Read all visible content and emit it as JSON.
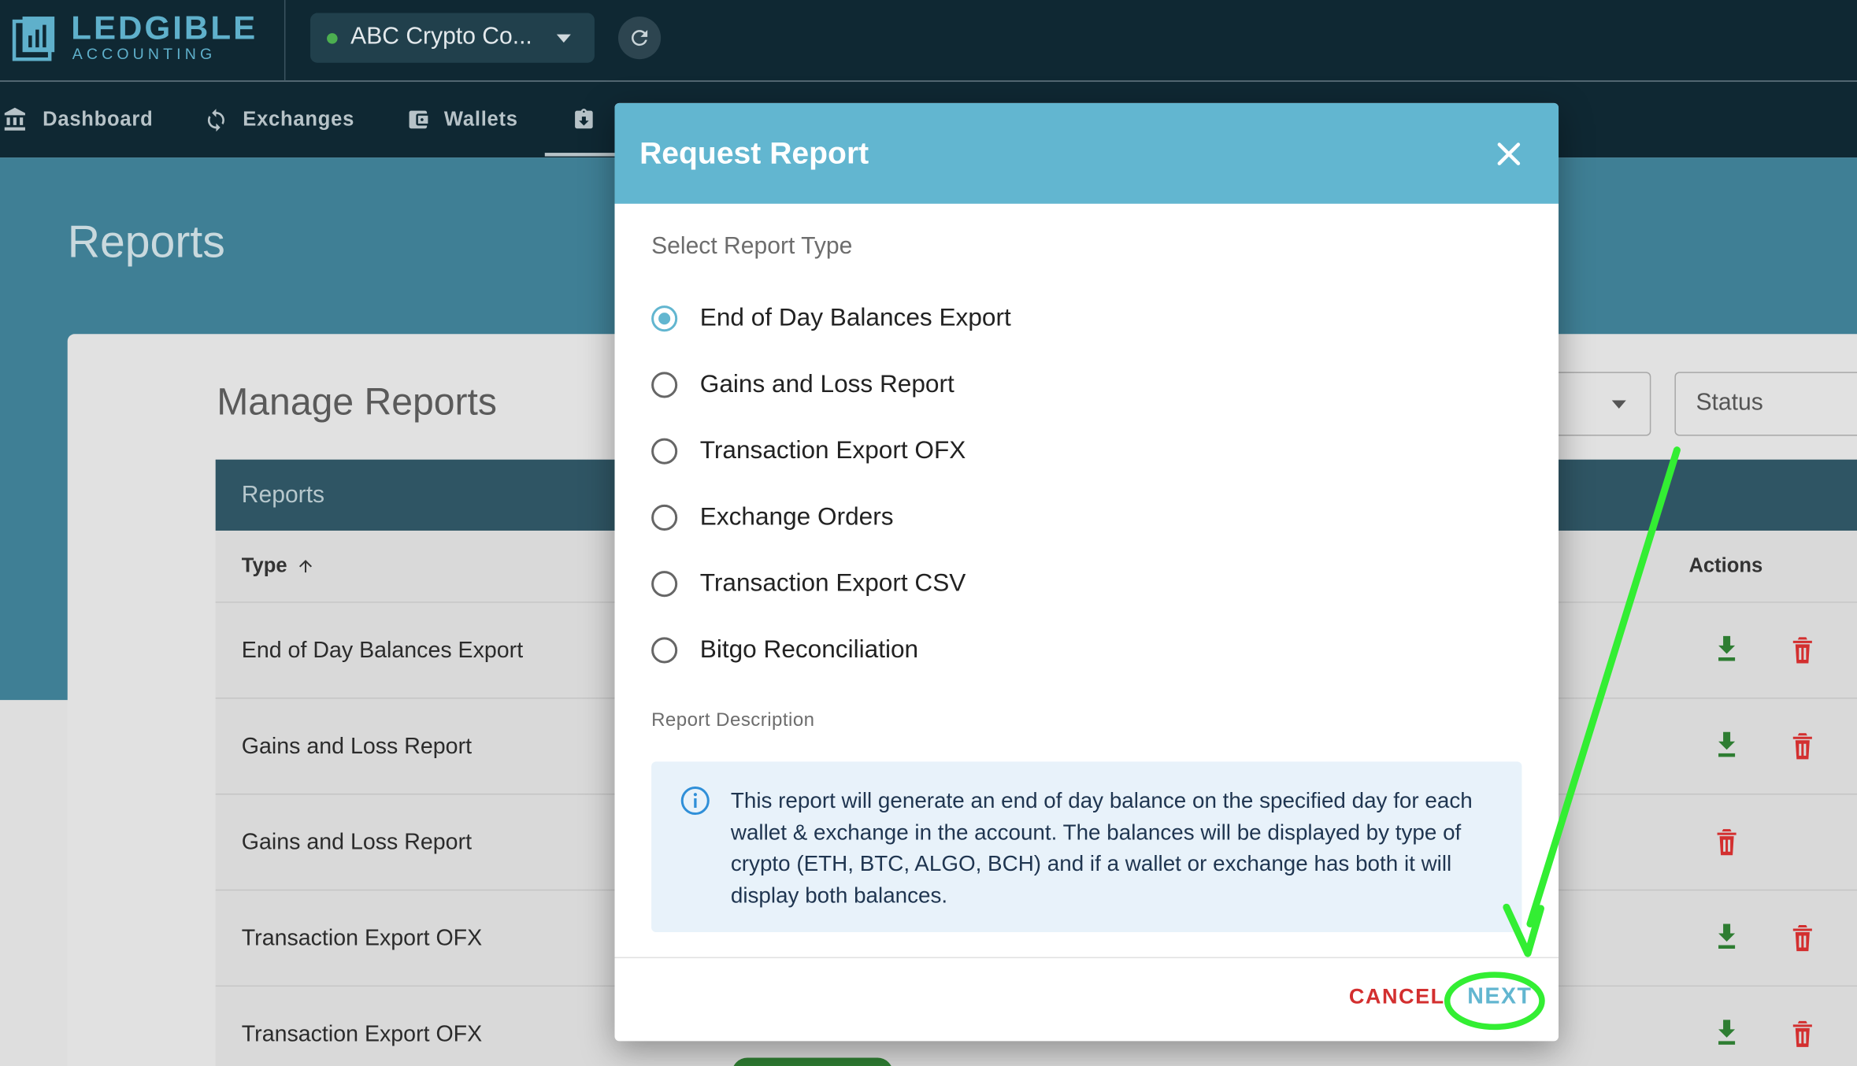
{
  "brand": {
    "name": "LEDGIBLE",
    "subtitle": "ACCOUNTING"
  },
  "org_selector": {
    "value": "ABC Crypto Co...",
    "status_color": "#4caf50"
  },
  "nav": {
    "items": [
      {
        "label": "Dashboard",
        "icon": "bank-icon"
      },
      {
        "label": "Exchanges",
        "icon": "sync-icon"
      },
      {
        "label": "Wallets",
        "icon": "wallet-icon"
      },
      {
        "label": "",
        "icon": "report-download-icon"
      }
    ]
  },
  "page": {
    "title": "Reports"
  },
  "manage": {
    "title": "Manage Reports",
    "status_placeholder": "Status",
    "table_title": "Reports",
    "columns": {
      "type": "Type",
      "actions": "Actions"
    },
    "rows": [
      {
        "type": "End of Day Balances Export"
      },
      {
        "type": "Gains and Loss Report"
      },
      {
        "type": "Gains and Loss Report"
      },
      {
        "type": "Transaction Export OFX"
      },
      {
        "type": "Transaction Export OFX"
      }
    ]
  },
  "modal": {
    "title": "Request Report",
    "section_label": "Select Report Type",
    "options": [
      {
        "label": "End of Day Balances Export",
        "selected": true
      },
      {
        "label": "Gains and Loss Report",
        "selected": false
      },
      {
        "label": "Transaction Export OFX",
        "selected": false
      },
      {
        "label": "Exchange Orders",
        "selected": false
      },
      {
        "label": "Transaction Export CSV",
        "selected": false
      },
      {
        "label": "Bitgo Reconciliation",
        "selected": false
      }
    ],
    "description_label": "Report Description",
    "description": "This report will generate an end of day balance on the specified day for each wallet & exchange in the account. The balances will be displayed by type of crypto (ETH, BTC, ALGO, BCH) and if a wallet or exchange has both it will display both balances.",
    "cancel_label": "CANCEL",
    "next_label": "NEXT"
  },
  "colors": {
    "accent": "#62b6d0",
    "topbar": "#0f2833",
    "danger": "#d32f2f",
    "success": "#2e7d32",
    "annotation": "#33ee33"
  }
}
